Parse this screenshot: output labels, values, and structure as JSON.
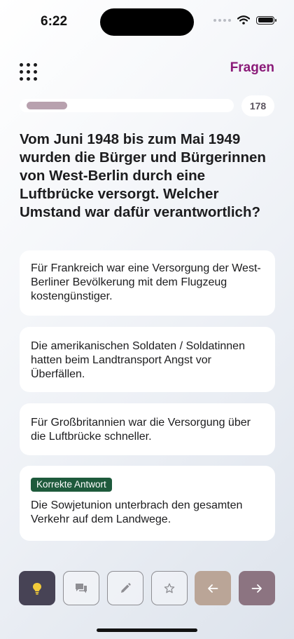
{
  "status_bar": {
    "time": "6:22"
  },
  "header": {
    "title": "Fragen",
    "menu_icon": "grid-icon"
  },
  "progress": {
    "fraction": 0.16,
    "count": "178"
  },
  "question": {
    "text": "Vom Juni 1948 bis zum Mai 1949 wurden die Bürger und Bürgerinnen von West-Berlin durch eine Luftbrücke versorgt. Welcher Umstand war dafür verantwortlich?"
  },
  "answers": [
    {
      "text": "Für Frankreich war eine Versorgung der West-Berliner Bevölkerung mit dem Flugzeug kostengünstiger."
    },
    {
      "text": "Die amerikanischen Soldaten / Soldatinnen hatten beim Landtransport Angst vor Überfällen."
    },
    {
      "text": "Für Großbritannien war die Versorgung über die Luftbrücke schneller."
    },
    {
      "text": "Die Sowjetunion unterbrach den gesamten Verkehr auf dem Landwege.",
      "badge": "Korrekte Antwort",
      "correct": true
    }
  ],
  "toolbar": {
    "buttons": [
      {
        "icon": "lightbulb-icon",
        "style": "filled",
        "color": "#474355"
      },
      {
        "icon": "chat-icon",
        "style": "outline"
      },
      {
        "icon": "pencil-icon",
        "style": "outline"
      },
      {
        "icon": "star-icon",
        "style": "outline"
      },
      {
        "icon": "arrow-left-icon",
        "style": "filled",
        "color": "#baa597"
      },
      {
        "icon": "arrow-right-icon",
        "style": "filled",
        "color": "#8c7481"
      }
    ]
  },
  "colors": {
    "accent": "#8a1a78",
    "correct_badge": "#1e5a3c",
    "progress_fill": "#b8a1ae",
    "card_bg": "#ffffff"
  }
}
